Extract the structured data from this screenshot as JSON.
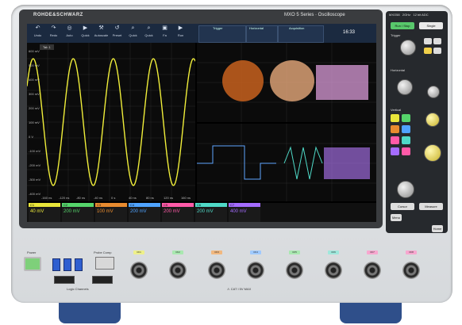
{
  "brand": "ROHDE&SCHWARZ",
  "model": "MXO 5 Series · Oscilloscope",
  "panel_header": {
    "left": "MXO58",
    "mid": "2GHz",
    "right": "12 bit ADC"
  },
  "toolbar": {
    "items": [
      "Undo",
      "Redo",
      "Auto",
      "Quick",
      "Autoscale",
      "Preset",
      "Quick",
      "Quick",
      "Fa",
      "Run"
    ],
    "tab_label": "Tab 1",
    "trigger_label": "Trigger",
    "horizontal_label": "Horizontal",
    "acquisition_label": "Acquisition",
    "time": "16:33"
  },
  "main_waveform": {
    "y_labels": [
      "600 mV",
      "500 mV",
      "400 mV",
      "300 mV",
      "200 mV",
      "100 mV",
      "0 V",
      "-100 mV",
      "-200 mV",
      "-300 mV",
      "-400 mV"
    ],
    "x_labels": [
      "-160 ns",
      "-120 ns",
      "-80 ns",
      "-40 ns",
      "0 s",
      "40 ns",
      "80 ns",
      "120 ns",
      "160 ns"
    ]
  },
  "channel_bar": [
    {
      "label": "C1",
      "value": "40 mV",
      "color": "#e9e63a"
    },
    {
      "label": "C2",
      "value": "200 mV",
      "color": "#55d46b"
    },
    {
      "label": "C3",
      "value": "100 mV",
      "color": "#e88b2f"
    },
    {
      "label": "C4",
      "value": "200 mV",
      "color": "#4fa3ff"
    },
    {
      "label": "C5",
      "value": "200 mV",
      "color": "#ff5aa8"
    },
    {
      "label": "C6",
      "value": "200 mV",
      "color": "#4fd9c7"
    },
    {
      "label": "C7",
      "value": "400 mV",
      "color": "#a46cff"
    }
  ],
  "right_panel": {
    "run_label": "Run / Stop",
    "single_label": "Single",
    "trigger_label": "Trigger",
    "horizontal_label": "Horizontal",
    "vertical_label": "Vertical",
    "cursor_label": "Cursor",
    "measure_label": "Measure",
    "menu_label": "Menu",
    "home_label": "Home"
  },
  "front": {
    "power_label": "Power",
    "probe_comp_label": "Probe Comp",
    "logic_label": "Logic Channels",
    "channels": [
      "Ch1",
      "Ch2",
      "Ch3",
      "Ch4",
      "Ch5",
      "Ch6",
      "Ch7",
      "Ch8"
    ],
    "channel_colors": [
      "#eef08a",
      "#a9e8b0",
      "#f1b87f",
      "#9fcaff",
      "#a9e8b0",
      "#9fe8dc",
      "#f7a7cf",
      "#f7a7cf"
    ],
    "warning": "⚠ CAT I 5V MAX"
  }
}
